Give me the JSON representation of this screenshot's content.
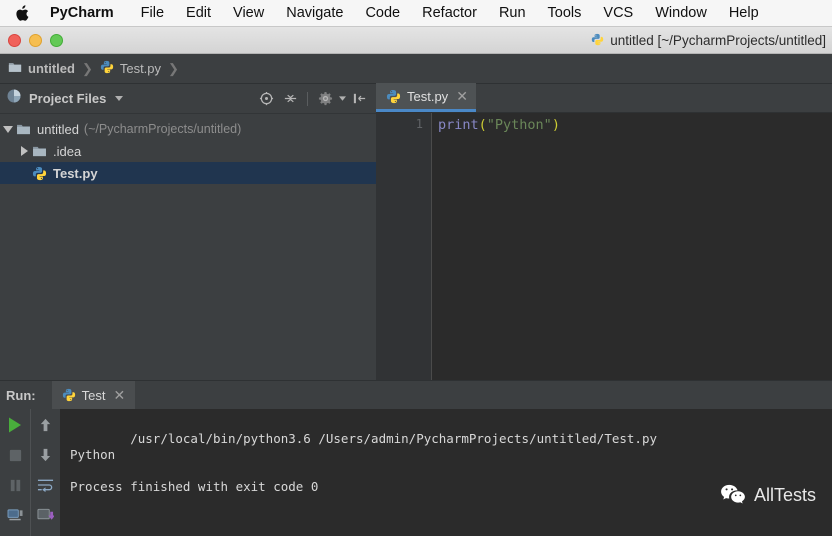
{
  "menubar": {
    "apple_icon": "apple-logo",
    "items": [
      {
        "label": "PyCharm",
        "bold": true
      },
      {
        "label": "File"
      },
      {
        "label": "Edit"
      },
      {
        "label": "View"
      },
      {
        "label": "Navigate"
      },
      {
        "label": "Code"
      },
      {
        "label": "Refactor"
      },
      {
        "label": "Run"
      },
      {
        "label": "Tools"
      },
      {
        "label": "VCS"
      },
      {
        "label": "Window"
      },
      {
        "label": "Help"
      }
    ]
  },
  "titlebar": {
    "title": "untitled [~/PycharmProjects/untitled]",
    "icon": "python-file-icon",
    "buttons": [
      "close",
      "minimize",
      "maximize"
    ]
  },
  "breadcrumb": {
    "project": "untitled",
    "separator": "❯",
    "file": "Test.py"
  },
  "project_panel": {
    "title": "Project Files",
    "dropdown_icon": "chevron-down-icon",
    "tools": [
      {
        "name": "locate-target-icon"
      },
      {
        "name": "collapse-all-icon"
      },
      {
        "name": "settings-gear-icon"
      },
      {
        "name": "hide-panel-icon"
      }
    ],
    "tree": [
      {
        "label": "untitled",
        "sub": "(~/PycharmProjects/untitled)",
        "state": "expanded",
        "icon": "folder-icon",
        "selected": false
      },
      {
        "label": ".idea",
        "sub": "",
        "state": "collapsed",
        "icon": "folder-icon",
        "selected": false
      },
      {
        "label": "Test.py",
        "sub": "",
        "state": "leaf",
        "icon": "python-file-icon",
        "selected": true
      }
    ]
  },
  "editor": {
    "tab": {
      "label": "Test.py",
      "icon": "python-file-icon",
      "close_icon": "close-icon",
      "active": true
    },
    "line_numbers": [
      "1"
    ],
    "code": {
      "func": "print",
      "open_paren": "(",
      "string": "\"Python\"",
      "close_paren": ")"
    }
  },
  "run_panel": {
    "label": "Run:",
    "tab": {
      "label": "Test",
      "icon": "python-file-icon",
      "close_icon": "close-icon"
    },
    "toolbar_primary": [
      {
        "name": "run-icon"
      },
      {
        "name": "stop-icon"
      },
      {
        "name": "pause-icon"
      },
      {
        "name": "console-icon"
      }
    ],
    "toolbar_secondary": [
      {
        "name": "arrow-up-icon"
      },
      {
        "name": "arrow-down-icon"
      },
      {
        "name": "soft-wrap-icon"
      },
      {
        "name": "export-icon"
      }
    ],
    "console_output": "/usr/local/bin/python3.6 /Users/admin/PycharmProjects/untitled/Test.py\nPython\n\nProcess finished with exit code 0"
  },
  "watermark": {
    "text": "AllTests",
    "icon": "wechat-icon"
  },
  "colors": {
    "panel_bg": "#3c3f41",
    "editor_bg": "#2b2b2b",
    "selection_blue": "#20354f",
    "tab_underline": "#4a88c7",
    "menubar_bg": "#f6f6f6",
    "string_green": "#6a8759",
    "func_purple": "#8888c6",
    "paren_yellow": "#cccc33",
    "run_green": "#49ad3c"
  }
}
